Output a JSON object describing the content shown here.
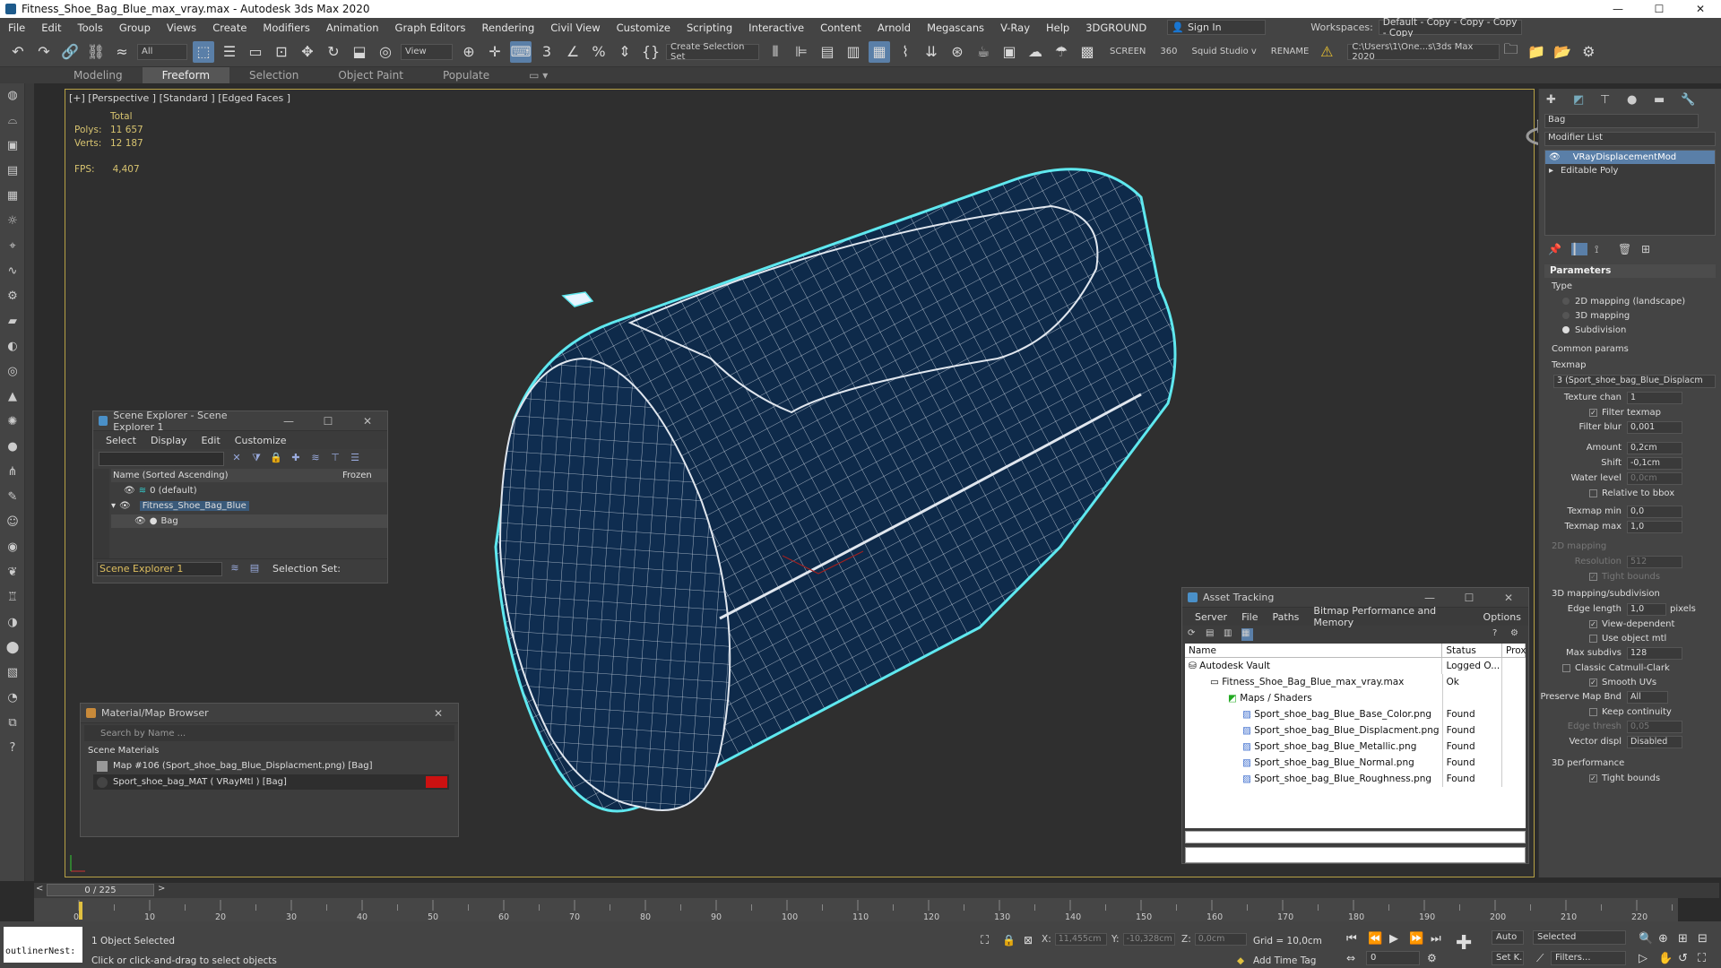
{
  "window": {
    "title": "Fitness_Shoe_Bag_Blue_max_vray.max - Autodesk 3ds Max 2020",
    "min": "—",
    "max": "☐",
    "close": "✕"
  },
  "menu": [
    "File",
    "Edit",
    "Tools",
    "Group",
    "Views",
    "Create",
    "Modifiers",
    "Animation",
    "Graph Editors",
    "Rendering",
    "Civil View",
    "Customize",
    "Scripting",
    "Interactive",
    "Content",
    "Arnold",
    "Megascans",
    "V-Ray",
    "Help",
    "3DGROUND"
  ],
  "signin": "Sign In",
  "workspaces": {
    "label": "Workspaces:",
    "value": "Default - Copy - Copy - Copy - Copy"
  },
  "toolbar": {
    "filter": "All",
    "view": "View",
    "selection_set": "Create Selection Set",
    "screen": "SCREEN",
    "num360": "360",
    "squid": "Squid Studio v",
    "rename": "RENAME",
    "path": "C:\\Users\\1\\One...s\\3ds Max 2020"
  },
  "ribbon": [
    "Modeling",
    "Freeform",
    "Selection",
    "Object Paint",
    "Populate"
  ],
  "viewport": {
    "label": "[+] [Perspective ] [Standard ] [Edged Faces ]",
    "total": "Total",
    "polys_label": "Polys:",
    "polys": "11 657",
    "verts_label": "Verts:",
    "verts": "12 187",
    "fps_label": "FPS:",
    "fps": "4,407"
  },
  "scene_explorer": {
    "title": "Scene Explorer - Scene Explorer 1",
    "menu": [
      "Select",
      "Display",
      "Edit",
      "Customize"
    ],
    "col_name": "Name (Sorted Ascending)",
    "col_frozen": "Frozen",
    "rows": [
      "0 (default)",
      "Fitness_Shoe_Bag_Blue",
      "Bag"
    ],
    "footer_name": "Scene Explorer 1",
    "selection_set": "Selection Set:"
  },
  "material_browser": {
    "title": "Material/Map Browser",
    "search": "Search by Name ...",
    "section": "Scene Materials",
    "items": [
      "Map #106 (Sport_shoe_bag_Blue_Displacment.png)  [Bag]",
      "Sport_shoe_bag_MAT  ( VRayMtl )  [Bag]"
    ]
  },
  "asset_tracking": {
    "title": "Asset Tracking",
    "menu": [
      "Server",
      "File",
      "Paths",
      "Bitmap Performance and Memory",
      "Options"
    ],
    "cols": [
      "Name",
      "Status",
      "Prox"
    ],
    "rows": [
      {
        "name": "Autodesk Vault",
        "status": "Logged O..."
      },
      {
        "name": "Fitness_Shoe_Bag_Blue_max_vray.max",
        "status": "Ok"
      },
      {
        "name": "Maps / Shaders",
        "status": ""
      },
      {
        "name": "Sport_shoe_bag_Blue_Base_Color.png",
        "status": "Found"
      },
      {
        "name": "Sport_shoe_bag_Blue_Displacment.png",
        "status": "Found"
      },
      {
        "name": "Sport_shoe_bag_Blue_Metallic.png",
        "status": "Found"
      },
      {
        "name": "Sport_shoe_bag_Blue_Normal.png",
        "status": "Found"
      },
      {
        "name": "Sport_shoe_bag_Blue_Roughness.png",
        "status": "Found"
      }
    ]
  },
  "command_panel": {
    "object_name": "Bag",
    "modifier_list": "Modifier List",
    "stack": [
      "VRayDisplacementMod",
      "Editable Poly"
    ],
    "parameters": "Parameters",
    "type_label": "Type",
    "types": [
      "2D mapping (landscape)",
      "3D mapping",
      "Subdivision"
    ],
    "common": "Common params",
    "texmap_label": "Texmap",
    "texmap": "3 (Sport_shoe_bag_Blue_Displacm",
    "texture_chan_l": "Texture chan",
    "texture_chan": "1",
    "filter_texmap": "Filter texmap",
    "filter_blur_l": "Filter blur",
    "filter_blur": "0,001",
    "amount_l": "Amount",
    "amount": "0,2cm",
    "shift_l": "Shift",
    "shift": "-0,1cm",
    "water_l": "Water level",
    "water": "0,0cm",
    "relative": "Relative to bbox",
    "texmin_l": "Texmap min",
    "texmin": "0,0",
    "texmax_l": "Texmap max",
    "texmax": "1,0",
    "map2d": "2D mapping",
    "res_l": "Resolution",
    "res": "512",
    "tight": "Tight bounds",
    "map3d": "3D mapping/subdivision",
    "edge_l": "Edge length",
    "edge": "1,0",
    "pixels": "pixels",
    "view_dep": "View-dependent",
    "use_obj": "Use object mtl",
    "maxsub_l": "Max subdivs",
    "maxsub": "128",
    "catmull": "Classic Catmull-Clark",
    "smooth": "Smooth UVs",
    "preserve_l": "Preserve Map Bnd",
    "preserve": "All",
    "keep": "Keep continuity",
    "edge_th_l": "Edge thresh",
    "edge_th": "0,05",
    "vector_l": "Vector displ",
    "vector": "Disabled",
    "perf": "3D performance",
    "tight2": "Tight bounds"
  },
  "timeline": {
    "frame": "0 / 225",
    "ticks": [
      "0",
      "10",
      "20",
      "30",
      "40",
      "50",
      "60",
      "70",
      "80",
      "90",
      "100",
      "110",
      "120",
      "130",
      "140",
      "150",
      "160",
      "170",
      "180",
      "190",
      "200",
      "210",
      "220"
    ]
  },
  "status": {
    "maxscript": "outlinerNest:",
    "selected": "1 Object Selected",
    "hint": "Click or click-and-drag to select objects",
    "x_l": "X:",
    "x": "11,455cm",
    "y_l": "Y:",
    "y": "-10,328cm",
    "z_l": "Z:",
    "z": "0,0cm",
    "grid": "Grid = 10,0cm",
    "add_time_tag": "Add Time Tag",
    "auto": "Auto",
    "selected_dd": "Selected",
    "setk": "Set K.",
    "filters": "Filters...",
    "frame_field": "0"
  }
}
